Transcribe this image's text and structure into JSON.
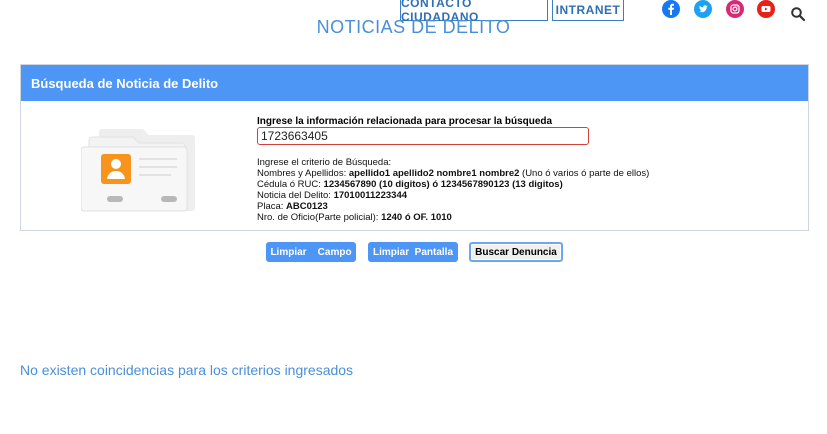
{
  "top_nav": {
    "contacto_label": "CONTACTO CIUDADANO",
    "intranet_label": "INTRANET"
  },
  "social": [
    "facebook-icon",
    "twitter-icon",
    "instagram-icon",
    "youtube-icon",
    "search-icon"
  ],
  "page": {
    "title": "NOTICIAS DE DELITO"
  },
  "panel": {
    "header": "Búsqueda de Noticia de Delito",
    "search_label": "Ingrese la información relacionada para procesar la búsqueda",
    "search_value": "1723663405",
    "criteria": {
      "intro": "Ingrese el criterio de Búsqueda:",
      "nombres_label": "Nombres y Apellidos: ",
      "nombres_value": "apellido1 apellido2 nombre1 nombre2",
      "nombres_note": " (Uno ó varios ó parte de ellos)",
      "cedula_label": "Cédula ó RUC: ",
      "cedula_value": "1234567890 (10 digitos) ó 1234567890123 (13 digitos)",
      "noticia_label": "Noticia del Delito: ",
      "noticia_value": "17010011223344",
      "placa_label": "Placa: ",
      "placa_value": "ABC0123",
      "oficio_label": "Nro. de Oficio(Parte policial): ",
      "oficio_value": "1240 ó OF. 1010"
    }
  },
  "buttons": {
    "limpiar_campo": "Limpiar    Campo",
    "limpiar_pantalla": "Limpiar  Pantalla",
    "buscar": "Buscar Denuncia"
  },
  "results": {
    "message": "No existen coincidencias para los criterios ingresados"
  },
  "colors": {
    "accent": "#4d96f5",
    "title": "#4a8fd8",
    "input_border": "#d4403a"
  }
}
